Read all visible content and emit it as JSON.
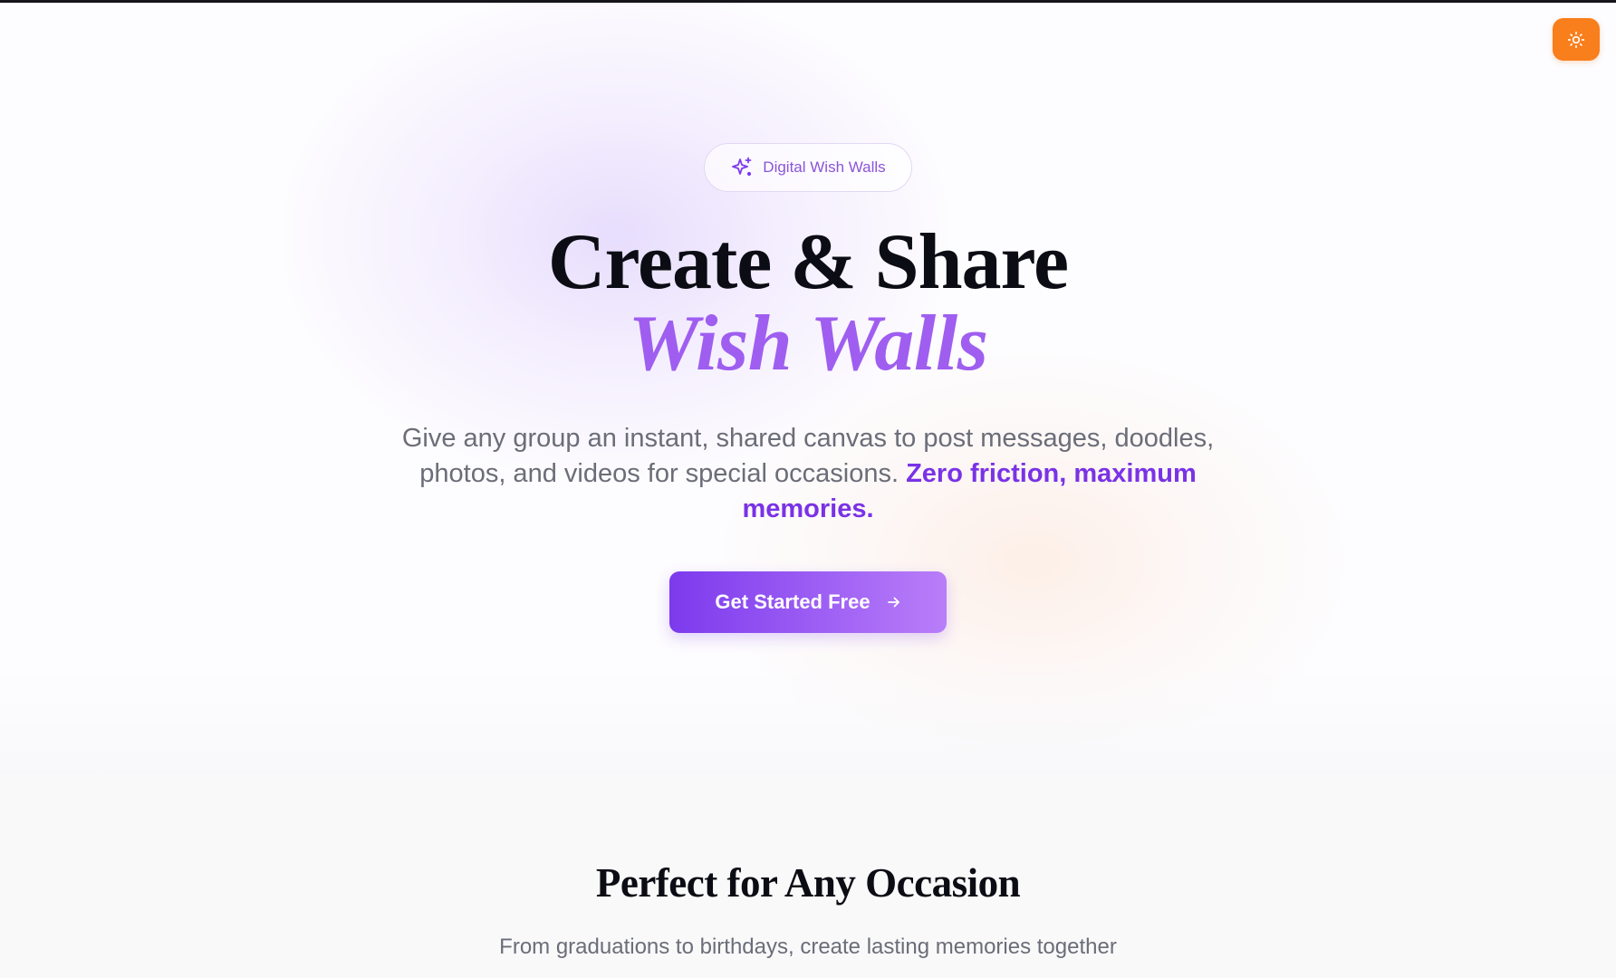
{
  "header": {
    "theme_toggle": {
      "icon": "sun-icon",
      "background_color": "#f97e1c"
    }
  },
  "hero": {
    "badge": {
      "icon": "sparkles-icon",
      "label": "Digital Wish Walls"
    },
    "headline": "Create & Share",
    "headline_accent": "Wish Walls",
    "subtext": "Give any group an instant, shared canvas to post messages, doodles, photos, and videos for special occasions.",
    "subtext_highlight": "Zero friction, maximum memories.",
    "cta": {
      "label": "Get Started Free",
      "icon": "arrow-right-icon"
    }
  },
  "occasions": {
    "title": "Perfect for Any Occasion",
    "subtitle": "From graduations to birthdays, create lasting memories together"
  },
  "colors": {
    "accent_purple": "#7c3aed",
    "accent_purple_light": "#b97ef9",
    "headline_accent": "#9f5ef0",
    "orange": "#f97e1c",
    "text_dark": "#0c0d14",
    "text_muted": "#6b6d78"
  }
}
